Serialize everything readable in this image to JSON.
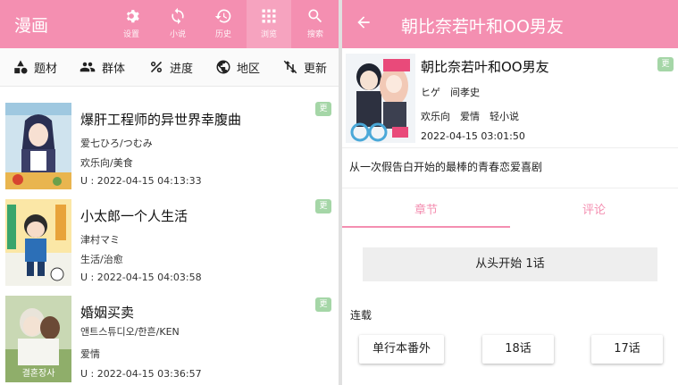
{
  "left": {
    "app_title": "漫画",
    "nav": [
      {
        "label": "设置",
        "icon": "gear-icon"
      },
      {
        "label": "小说",
        "icon": "sync-icon"
      },
      {
        "label": "历史",
        "icon": "history-icon"
      },
      {
        "label": "浏览",
        "icon": "grid-icon"
      },
      {
        "label": "搜索",
        "icon": "search-icon"
      }
    ],
    "filters": [
      {
        "label": "题材",
        "icon": "shapes-icon"
      },
      {
        "label": "群体",
        "icon": "people-icon"
      },
      {
        "label": "进度",
        "icon": "percent-icon"
      },
      {
        "label": "地区",
        "icon": "globe-icon"
      },
      {
        "label": "更新",
        "icon": "sort-icon"
      }
    ],
    "manga": [
      {
        "title": "爆肝工程师的异世界幸腹曲",
        "author": "爱七ひろ/つむみ",
        "tags": "欢乐向/美食",
        "update": "U : 2022-04-15 04:13:33",
        "badge": "更"
      },
      {
        "title": "小太郎一个人生活",
        "author": "津村マミ",
        "tags": "生活/治愈",
        "update": "U : 2022-04-15 04:03:58",
        "badge": "更"
      },
      {
        "title": "婚姻买卖",
        "author": "앤트스튜디오/한흔/KEN",
        "tags": "爱情",
        "update": "U : 2022-04-15 03:36:57",
        "badge": "更"
      }
    ]
  },
  "right": {
    "header_title": "朝比奈若叶和OO男友",
    "detail": {
      "title": "朝比奈若叶和OO男友",
      "authors": "ヒゲ　间孝史",
      "tags": "欢乐向　爱情　轻小说",
      "date": "2022-04-15 03:01:50",
      "badge": "更",
      "description": "从一次假告白开始的最棒的青春恋爱喜剧"
    },
    "tabs": [
      "章节",
      "评论"
    ],
    "start_button": "从头开始 1话",
    "section_label": "连载",
    "chapters": [
      "单行本番外",
      "18话",
      "17话"
    ]
  },
  "colors": {
    "accent": "#f48fb1",
    "badge": "#a5d6a7"
  }
}
